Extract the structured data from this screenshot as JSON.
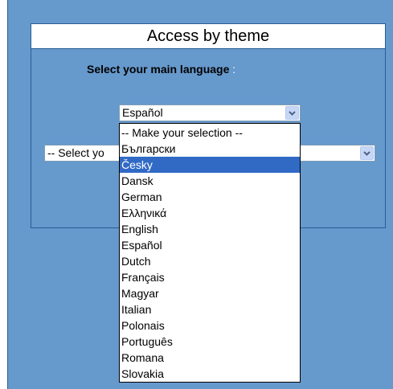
{
  "panel": {
    "title": "Access by theme"
  },
  "language": {
    "label": "Select your main language",
    "colon": ":",
    "selected_value": "Español",
    "options": [
      "-- Make your selection --",
      "Български",
      "Česky",
      "Dansk",
      "German",
      "Ελληνικά",
      "English",
      "Español",
      "Dutch",
      "Français",
      "Magyar",
      "Italian",
      "Polonais",
      "Português",
      "Romana",
      "Slovakia"
    ],
    "highlighted_option": "Česky"
  },
  "theme": {
    "selected_value": "-- Select yo"
  },
  "icons": {
    "dropdown_arrow": "chevron-down-icon"
  },
  "colors": {
    "background": "#6699cc",
    "selection": "#316ac5",
    "border": "#2a5d96"
  }
}
